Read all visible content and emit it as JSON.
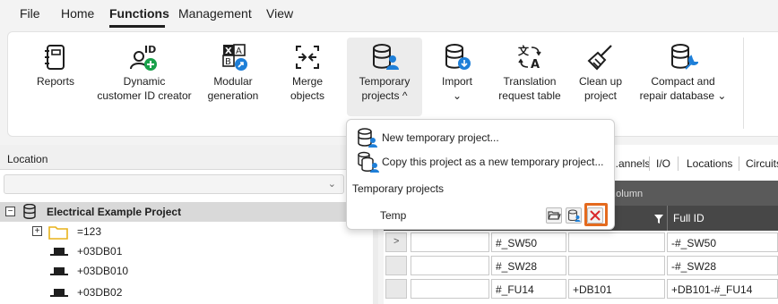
{
  "menu": {
    "items": [
      {
        "label": "File",
        "active": false
      },
      {
        "label": "Home",
        "active": false
      },
      {
        "label": "Functions",
        "active": true
      },
      {
        "label": "Management",
        "active": false
      },
      {
        "label": "View",
        "active": false
      }
    ]
  },
  "ribbon": {
    "buttons": [
      {
        "line1": "Reports",
        "line2": "",
        "icon": "reports-icon"
      },
      {
        "line1": "Dynamic",
        "line2": "customer ID creator",
        "icon": "customer-id-icon"
      },
      {
        "line1": "Modular",
        "line2": "generation",
        "icon": "modular-generation-icon"
      },
      {
        "line1": "Merge",
        "line2": "objects",
        "icon": "merge-objects-icon"
      },
      {
        "line1": "Temporary",
        "line2": "projects ^",
        "icon": "temporary-projects-icon"
      },
      {
        "line1": "Import",
        "line2": "⌄",
        "icon": "import-icon"
      },
      {
        "line1": "Translation",
        "line2": "request table",
        "icon": "translation-icon"
      },
      {
        "line1": "Clean up",
        "line2": "project",
        "icon": "broom-icon"
      },
      {
        "line1": "Compact and",
        "line2": "repair database ⌄",
        "icon": "repair-database-icon"
      }
    ]
  },
  "popup": {
    "new_label": "New temporary project...",
    "copy_label": "Copy this project as a new temporary project...",
    "section_title": "Temporary projects",
    "temp_name": "Temp"
  },
  "location": {
    "header": "Location",
    "combo_value": ""
  },
  "tree": {
    "root": "Electrical Example Project",
    "items": [
      "=123",
      "+03DB01",
      "+03DB010",
      "+03DB02"
    ]
  },
  "tabs": [
    "...annels",
    "I/O",
    "Locations",
    "Circuits"
  ],
  "grid": {
    "group_hint": "...olumn",
    "headers": [
      "",
      "Full ID"
    ],
    "rows": [
      {
        "c1": "#_SW50",
        "c2": "",
        "c3": "-#_SW50"
      },
      {
        "c1": "#_SW28",
        "c2": "",
        "c3": "-#_SW28"
      },
      {
        "c1": "#_FU14",
        "c2": "+DB101",
        "c3": "+DB101-#_FU14"
      }
    ]
  },
  "colors": {
    "accent_blue": "#1e7fd8",
    "green_badge": "#19a04a",
    "highlight_orange": "#e46a1e"
  }
}
